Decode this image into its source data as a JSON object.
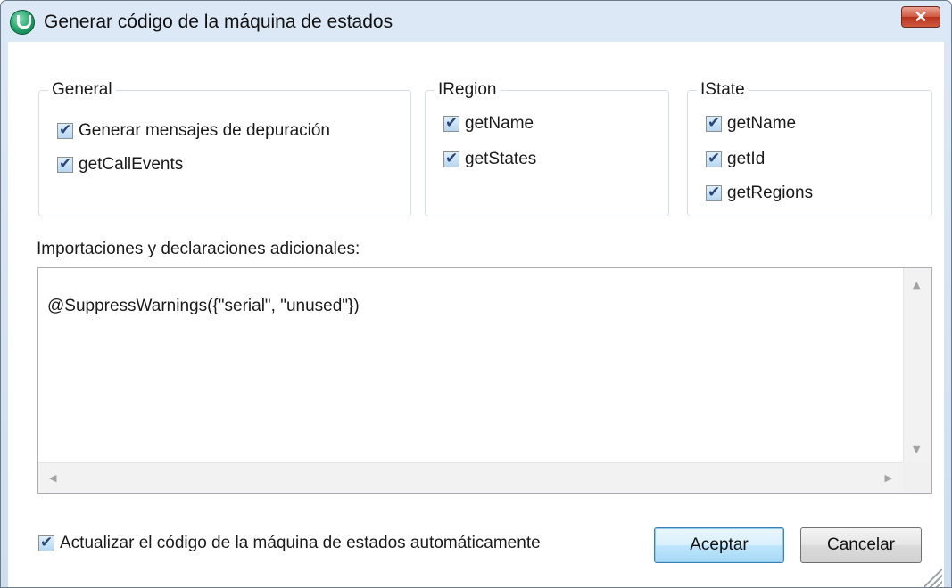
{
  "window": {
    "title": "Generar código de la máquina de estados",
    "close_label": "✕"
  },
  "general": {
    "label": "General",
    "items": [
      {
        "label": "Generar mensajes de depuración",
        "checked": true
      },
      {
        "label": "getCallEvents",
        "checked": true
      }
    ]
  },
  "iregion": {
    "label": "IRegion",
    "items": [
      {
        "label": "getName",
        "checked": true
      },
      {
        "label": "getStates",
        "checked": true
      }
    ]
  },
  "istate": {
    "label": "IState",
    "items": [
      {
        "label": "getName",
        "checked": true
      },
      {
        "label": "getId",
        "checked": true
      },
      {
        "label": "getRegions",
        "checked": true
      }
    ]
  },
  "imports": {
    "label": "Importaciones y declaraciones adicionales:",
    "value": "@SuppressWarnings({\"serial\", \"unused\"})"
  },
  "footer": {
    "auto_update_label": "Actualizar el código de la máquina de estados automáticamente",
    "auto_update_checked": true,
    "ok_label": "Aceptar",
    "cancel_label": "Cancelar"
  },
  "colors": {
    "accent": "#3c7fb1",
    "close_button": "#c7432b",
    "app_icon": "#1c9a63"
  }
}
